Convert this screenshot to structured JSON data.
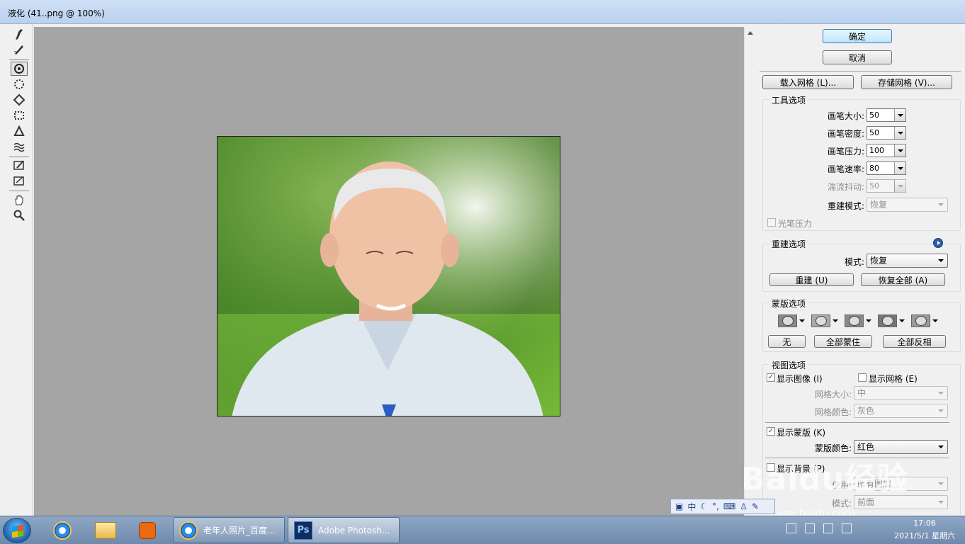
{
  "window": {
    "title": "液化 (41..png @ 100%)"
  },
  "tools": [
    {
      "name": "forward-warp-tool-icon"
    },
    {
      "name": "reconstruct-tool-icon"
    },
    {
      "name": "twirl-clockwise-tool-icon",
      "active": true
    },
    {
      "name": "pucker-tool-icon"
    },
    {
      "name": "bloat-tool-icon"
    },
    {
      "name": "push-left-tool-icon"
    },
    {
      "name": "mirror-tool-icon"
    },
    {
      "name": "turbulence-tool-icon"
    },
    {
      "name": "freeze-mask-tool-icon"
    },
    {
      "name": "thaw-mask-tool-icon"
    },
    {
      "name": "hand-tool-icon"
    },
    {
      "name": "zoom-tool-icon"
    }
  ],
  "panel": {
    "ok": "确定",
    "cancel": "取消",
    "load_mesh": "载入网格 (L)...",
    "save_mesh": "存储网格 (V)...",
    "tool_options": {
      "title": "工具选项",
      "brush_size_label": "画笔大小:",
      "brush_size": "50",
      "brush_density_label": "画笔密度:",
      "brush_density": "50",
      "brush_pressure_label": "画笔压力:",
      "brush_pressure": "100",
      "brush_rate_label": "画笔速率:",
      "brush_rate": "80",
      "turbulent_jitter_label": "湍流抖动:",
      "turbulent_jitter": "50",
      "reconstruct_mode_label": "重建模式:",
      "reconstruct_mode": "恢复",
      "stylus_pressure_label": "光笔压力"
    },
    "reconstruct_options": {
      "title": "重建选项",
      "mode_label": "模式:",
      "mode": "恢复",
      "reconstruct_btn": "重建 (U)",
      "restore_all_btn": "恢复全部 (A)"
    },
    "mask_options": {
      "title": "蒙版选项",
      "none_btn": "无",
      "mask_all_btn": "全部蒙住",
      "invert_all_btn": "全部反相"
    },
    "view_options": {
      "title": "视图选项",
      "show_image_label": "显示图像 (I)",
      "show_mesh_label": "显示网格 (E)",
      "mesh_size_label": "网格大小:",
      "mesh_size": "中",
      "mesh_color_label": "网格颜色:",
      "mesh_color": "灰色",
      "show_mask_label": "显示蒙版 (K)",
      "mask_color_label": "蒙版颜色:",
      "mask_color": "红色",
      "show_backdrop_label": "显示背景 (P)",
      "use_label": "使用:",
      "use": "所有图层",
      "mode_label": "模式:",
      "mode": "前面"
    }
  },
  "ime": {
    "lang": "中"
  },
  "watermark": {
    "brand": "Baidu经验",
    "url": "jingyan.baidu.com"
  },
  "taskbar": {
    "tasks": [
      {
        "label": "老年人照片_百度..."
      },
      {
        "label": "Adobe Photosh..."
      }
    ],
    "time": "17:06",
    "date": "2021/5/1 星期六"
  }
}
